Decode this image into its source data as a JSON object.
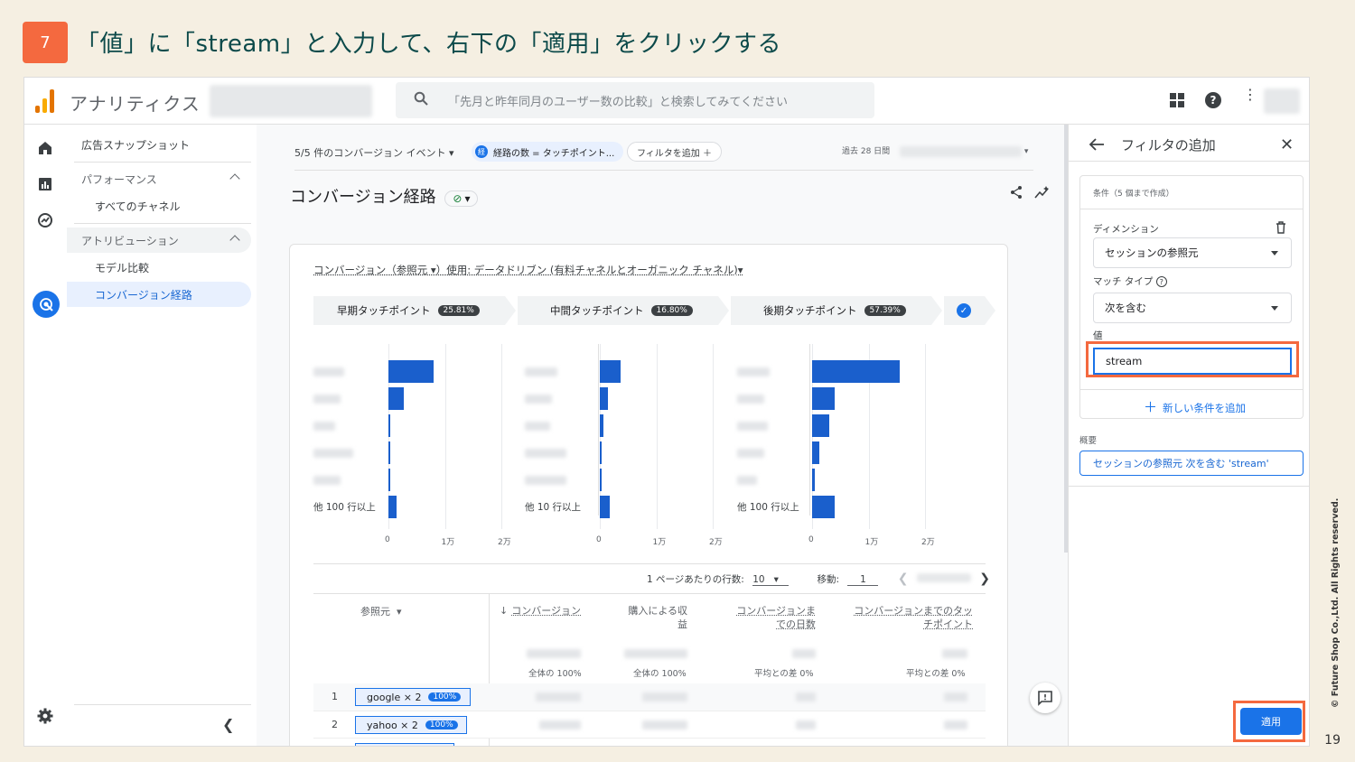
{
  "slide": {
    "step_number": "7",
    "title": "「値」に「stream」と入力して、右下の「適用」をクリックする",
    "copyright": "© Future Shop Co.,Ltd. All Rights reserved.",
    "page_number": "19"
  },
  "topbar": {
    "app_name": "アナリティクス",
    "search_placeholder": "「先月と昨年同月のユーザー数の比較」と検索してみてください"
  },
  "nav": {
    "items": [
      {
        "label": "広告スナップショット"
      },
      {
        "label": "パフォーマンス"
      },
      {
        "label": "すべてのチャネル"
      },
      {
        "label": "アトリビューション"
      },
      {
        "label": "モデル比較"
      },
      {
        "label": "コンバージョン経路"
      }
    ]
  },
  "report": {
    "event_filter": "5/5 件のコンバージョン イベント",
    "path_chip_badge": "経",
    "path_chip": "経路の数 = タッチポイント...",
    "add_filter": "フィルタを追加",
    "date_label": "過去 28 日間",
    "title": "コンバージョン経路",
    "model_line": "コンバージョン（参照元 ▾）使用: データドリブン (有料チャネルとオーガニック チャネル)▾",
    "stages": [
      {
        "label": "早期タッチポイント",
        "pct": "25.81%"
      },
      {
        "label": "中間タッチポイント",
        "pct": "16.80%"
      },
      {
        "label": "後期タッチポイント",
        "pct": "57.39%"
      }
    ],
    "other_labels": [
      "他 100 行以上",
      "他 10 行以上",
      "他 100 行以上"
    ],
    "axis_ticks": [
      "0",
      "1万",
      "2万"
    ],
    "pager": {
      "rows_label": "1 ページあたりの行数:",
      "rows_value": "10",
      "goto_label": "移動:",
      "goto_value": "1"
    },
    "table": {
      "headers": {
        "source": "参照元",
        "conversions": "コンバージョン",
        "revenue": "購入による収益",
        "days": "コンバージョンまでの日数",
        "touchpoints": "コンバージョンまでのタッチポイント"
      },
      "subtotals": [
        "全体の 100%",
        "全体の 100%",
        "平均との差 0%",
        "平均との差 0%"
      ],
      "rows": [
        {
          "num": "1",
          "path": "google × 2",
          "pct": "100%"
        },
        {
          "num": "2",
          "path": "yahoo × 2",
          "pct": "100%"
        }
      ]
    }
  },
  "panel": {
    "title": "フィルタの追加",
    "conditions_hint": "条件（5 個まで作成）",
    "dimension_label": "ディメンション",
    "dimension_value": "セッションの参照元",
    "match_label": "マッチ タイプ",
    "match_value": "次を含む",
    "value_label": "値",
    "value_input": "stream",
    "add_condition": "新しい条件を追加",
    "summary_label": "概要",
    "summary_text": "セッションの参照元 次を含む 'stream'",
    "apply_label": "適用"
  },
  "chart_data": {
    "type": "bar",
    "series": [
      {
        "name": "早期タッチポイント",
        "values": [
          8000,
          2700,
          300,
          300,
          300,
          1400
        ]
      },
      {
        "name": "中間タッチポイント",
        "values": [
          3600,
          1400,
          700,
          300,
          300,
          1800
        ]
      },
      {
        "name": "後期タッチポイント",
        "values": [
          15500,
          4000,
          3000,
          1300,
          500,
          4000
        ]
      }
    ],
    "xlim": [
      0,
      20000
    ]
  },
  "colors": {
    "accent": "#1a73e8",
    "bar": "#1a5fcc",
    "highlight": "#f4693f"
  }
}
